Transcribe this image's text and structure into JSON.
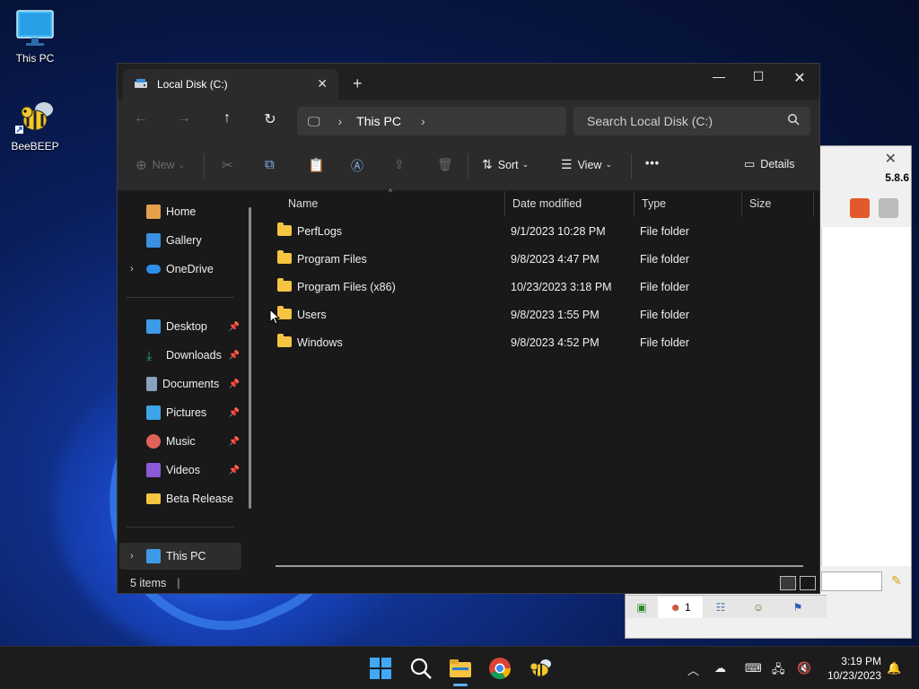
{
  "desktop": {
    "icons": [
      {
        "label": "This PC",
        "icon": "monitor-icon"
      },
      {
        "label": "BeeBEEP",
        "icon": "bee-icon"
      }
    ]
  },
  "bee_window": {
    "version": "5.8.6",
    "user_count": "1"
  },
  "explorer": {
    "tab_title": "Local Disk (C:)",
    "new_tab": "+",
    "address": {
      "location": "This PC"
    },
    "search_placeholder": "Search Local Disk (C:)",
    "toolbar": {
      "new_label": "New",
      "sort_label": "Sort",
      "view_label": "View",
      "more_label": "•••",
      "details_label": "Details"
    },
    "nav": {
      "items": [
        {
          "label": "Home",
          "icon": "home-icon",
          "color": "#e4a04a"
        },
        {
          "label": "Gallery",
          "icon": "gallery-icon",
          "color": "#3b8fe0"
        },
        {
          "label": "OneDrive",
          "icon": "cloud-icon",
          "color": "#2f8ee8"
        },
        {
          "label": "Desktop",
          "icon": "desktop-icon",
          "color": "#3d9ae8",
          "pinned": true
        },
        {
          "label": "Downloads",
          "icon": "download-icon",
          "color": "#28b06a",
          "pinned": true
        },
        {
          "label": "Documents",
          "icon": "document-icon",
          "color": "#8aa1c0",
          "pinned": true
        },
        {
          "label": "Pictures",
          "icon": "picture-icon",
          "color": "#3ba5e8",
          "pinned": true
        },
        {
          "label": "Music",
          "icon": "music-icon",
          "color": "#e0625a",
          "pinned": true
        },
        {
          "label": "Videos",
          "icon": "video-icon",
          "color": "#8a5ad8",
          "pinned": true
        },
        {
          "label": "Beta Release",
          "icon": "folder-icon",
          "color": "#f5c542"
        },
        {
          "label": "This PC",
          "icon": "pc-icon",
          "color": "#3d9ae8"
        }
      ]
    },
    "columns": {
      "name": "Name",
      "date": "Date modified",
      "type": "Type",
      "size": "Size"
    },
    "files": [
      {
        "name": "PerfLogs",
        "date": "9/1/2023 10:28 PM",
        "type": "File folder",
        "size": ""
      },
      {
        "name": "Program Files",
        "date": "9/8/2023 4:47 PM",
        "type": "File folder",
        "size": ""
      },
      {
        "name": "Program Files (x86)",
        "date": "10/23/2023 3:18 PM",
        "type": "File folder",
        "size": ""
      },
      {
        "name": "Users",
        "date": "9/8/2023 1:55 PM",
        "type": "File folder",
        "size": ""
      },
      {
        "name": "Windows",
        "date": "9/8/2023 4:52 PM",
        "type": "File folder",
        "size": ""
      }
    ],
    "status": {
      "item_count": "5 items"
    }
  },
  "taskbar": {
    "clock_time": "3:19 PM",
    "clock_date": "10/23/2023"
  }
}
